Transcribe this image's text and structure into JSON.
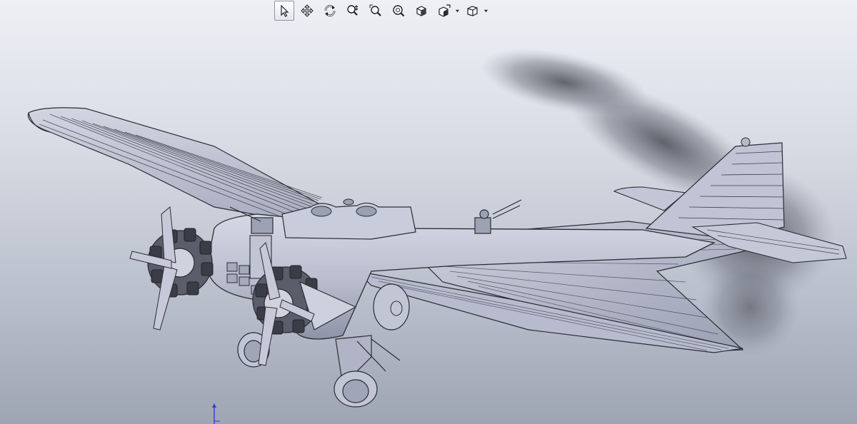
{
  "view_toolbar": {
    "tools": [
      {
        "name": "select-tool",
        "icon": "arrow-pointer-icon",
        "active": true
      },
      {
        "name": "pan-tool",
        "icon": "four-way-arrow-icon",
        "active": false
      },
      {
        "name": "rotate-tool",
        "icon": "rotate-view-icon",
        "active": false
      },
      {
        "name": "zoom-in-out-tool",
        "icon": "zoom-in-out-icon",
        "active": false
      },
      {
        "name": "zoom-to-area-tool",
        "icon": "zoom-area-icon",
        "active": false
      },
      {
        "name": "zoom-to-fit-tool",
        "icon": "zoom-fit-icon",
        "active": false
      },
      {
        "name": "view-orientation-tool",
        "icon": "cube-icon",
        "active": false
      },
      {
        "name": "display-style-tool",
        "icon": "shaded-cube-icon",
        "active": false,
        "has_dropdown": true
      },
      {
        "name": "hide-show-tool",
        "icon": "wireframe-cube-icon",
        "active": false,
        "has_dropdown": true
      }
    ]
  },
  "colors": {
    "model_body": "#c8cad8",
    "model_shade": "#9498ac",
    "model_edge": "#2b2c33",
    "triad_axis": "#2f3fd6"
  },
  "triad_icon": "coordinate-triad-icon"
}
